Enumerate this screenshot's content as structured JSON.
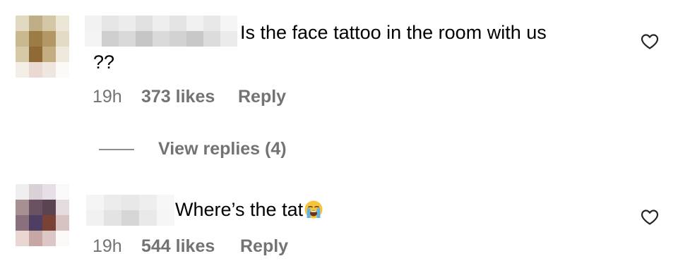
{
  "comments": [
    {
      "text_line1": "Is the face tattoo in the room with us",
      "text_line2": "??",
      "time": "19h",
      "likes": "373 likes",
      "reply_label": "Reply",
      "liked": false
    },
    {
      "text": "Where’s the tat",
      "emoji": "loudly-crying-face",
      "time": "19h",
      "likes": "544 likes",
      "reply_label": "Reply",
      "liked": false
    }
  ],
  "view_replies": {
    "label": "View replies (4)"
  },
  "colors": {
    "meta_text": "#737373",
    "primary_text": "#000000"
  },
  "icons": {
    "like": "heart-outline-icon",
    "replies_divider": "horizontal-line"
  }
}
